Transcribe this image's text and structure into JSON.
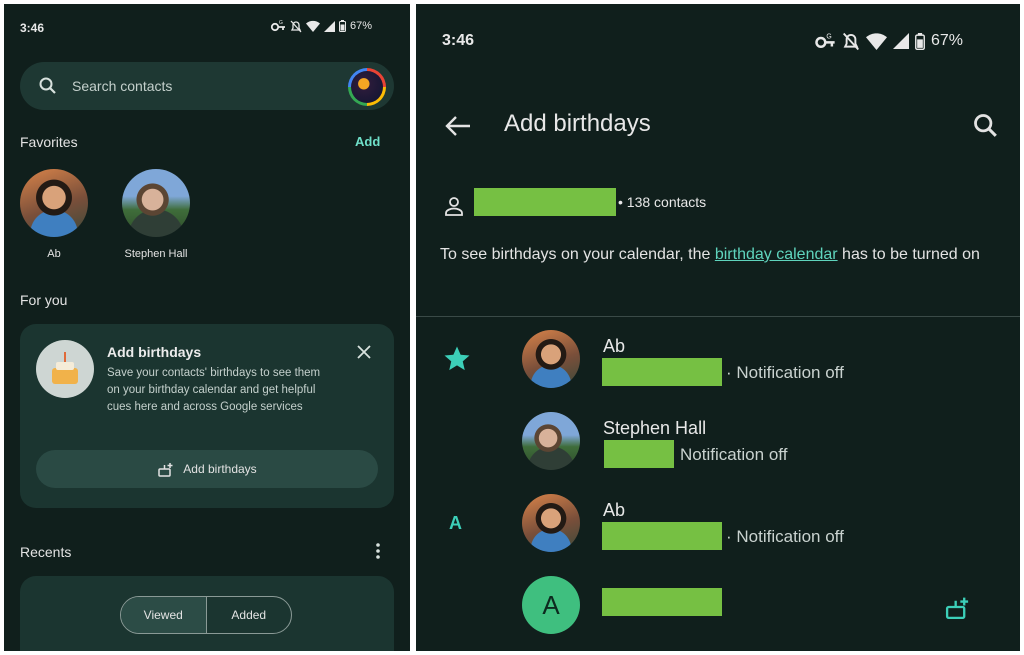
{
  "left": {
    "status": {
      "time": "3:46",
      "battery": "67%"
    },
    "search": {
      "placeholder": "Search contacts"
    },
    "favorites": {
      "heading": "Favorites",
      "add_label": "Add",
      "items": [
        {
          "name": "Ab"
        },
        {
          "name": "Stephen Hall"
        }
      ]
    },
    "for_you": {
      "heading": "For you",
      "card": {
        "title": "Add birthdays",
        "body": "Save your contacts' birthdays to see them on your birthday calendar and get helpful cues here and across Google services",
        "button": "Add birthdays"
      }
    },
    "recents": {
      "heading": "Recents",
      "segments": [
        "Viewed",
        "Added"
      ]
    }
  },
  "right": {
    "status": {
      "time": "3:46",
      "battery": "67%"
    },
    "title": "Add birthdays",
    "account_count": "• 138 contacts",
    "message": {
      "before": "To see birthdays on your calendar, the ",
      "link": "birthday calendar",
      "after": " has to be turned on"
    },
    "contacts": [
      {
        "name": "Ab",
        "note": "· Notification off"
      },
      {
        "name": "Stephen Hall",
        "note": "Notification off"
      },
      {
        "name": "Ab",
        "note": "· Notification off"
      },
      {
        "initial": "A"
      }
    ],
    "section_letter": "A"
  }
}
